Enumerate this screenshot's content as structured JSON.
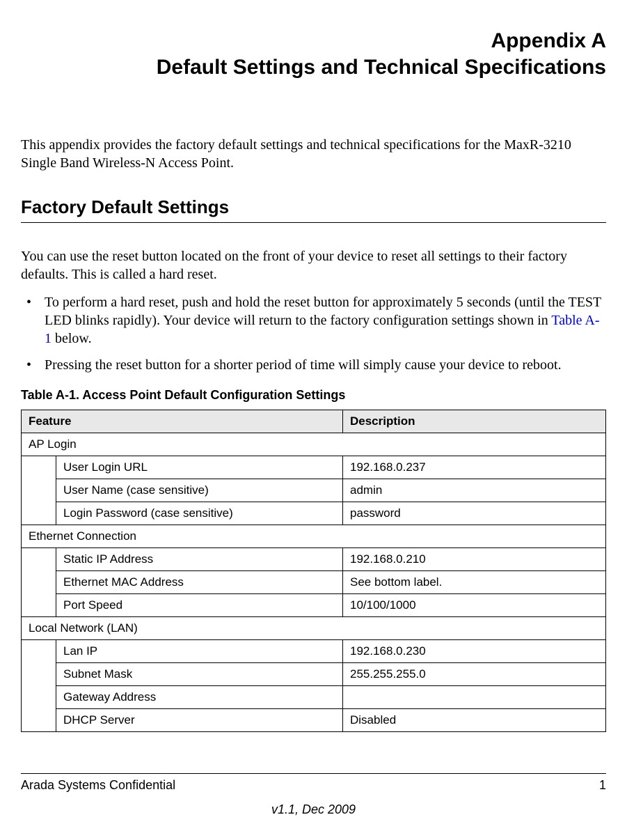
{
  "header": {
    "line1": "Appendix A",
    "line2": "Default Settings and Technical Specifications"
  },
  "intro": "This appendix provides the factory default settings and technical specifications for the MaxR-3210 Single Band Wireless-N Access Point.",
  "section_heading": "Factory Default Settings",
  "para1": "You can use the reset button located on the front of your device to reset all settings to their factory defaults. This is called a hard reset.",
  "bullets": {
    "b1_pre": "To perform a hard reset, push and hold the reset button for approximately 5 seconds (until the TEST LED blinks rapidly). Your device will return to the factory configuration settings shown in ",
    "b1_link": "Table A-1",
    "b1_post": " below.",
    "b2": "Pressing the reset button for a shorter period of time will simply cause your device to reboot."
  },
  "table": {
    "caption": "Table A-1.  Access Point Default Configuration Settings",
    "col_feature": "Feature",
    "col_desc": "Description",
    "groups": [
      {
        "name": "AP Login",
        "rows": [
          {
            "feature": "User Login URL",
            "desc": "192.168.0.237"
          },
          {
            "feature": "User Name (case sensitive)",
            "desc": "admin"
          },
          {
            "feature": "Login Password (case sensitive)",
            "desc": "password"
          }
        ]
      },
      {
        "name": "Ethernet Connection",
        "rows": [
          {
            "feature": "Static IP Address",
            "desc": "192.168.0.210"
          },
          {
            "feature": "Ethernet MAC Address",
            "desc": "See bottom label."
          },
          {
            "feature": "Port Speed",
            "desc": "10/100/1000"
          }
        ]
      },
      {
        "name": "Local Network (LAN)",
        "rows": [
          {
            "feature": "Lan IP",
            "desc": "192.168.0.230"
          },
          {
            "feature": "Subnet Mask",
            "desc": "255.255.255.0"
          },
          {
            "feature": "Gateway Address",
            "desc": ""
          },
          {
            "feature": "DHCP Server",
            "desc": "Disabled"
          }
        ]
      }
    ]
  },
  "footer": {
    "left": "Arada Systems Confidential",
    "right": "1",
    "version": "v1.1, Dec 2009"
  }
}
